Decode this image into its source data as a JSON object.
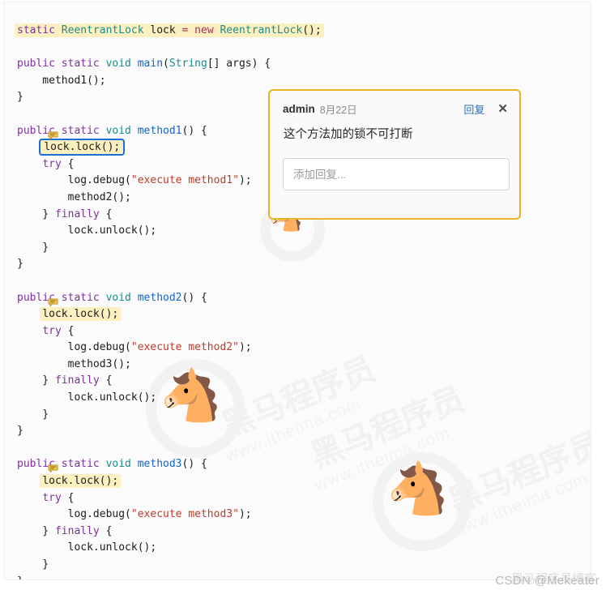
{
  "code": {
    "language": "java",
    "lines": [
      [
        {
          "t": "static ",
          "c": "kw"
        },
        {
          "t": "ReentrantLock",
          "c": "typ"
        },
        {
          "t": " lock ",
          "c": "pln"
        },
        {
          "t": "=",
          "c": "pnk"
        },
        {
          "t": " ",
          "c": "pln"
        },
        {
          "t": "new",
          "c": "pnk"
        },
        {
          "t": " ",
          "c": "pln"
        },
        {
          "t": "ReentrantLock",
          "c": "typ"
        },
        {
          "t": "();",
          "c": "pln"
        }
      ],
      [],
      [
        {
          "t": "public static ",
          "c": "kw"
        },
        {
          "t": "void",
          "c": "typ"
        },
        {
          "t": " ",
          "c": "pln"
        },
        {
          "t": "main",
          "c": "fn"
        },
        {
          "t": "(",
          "c": "pln"
        },
        {
          "t": "String",
          "c": "typ"
        },
        {
          "t": "[] args) {",
          "c": "pln"
        }
      ],
      [
        {
          "t": "    method1();",
          "c": "pln"
        }
      ],
      [
        {
          "t": "}",
          "c": "pln"
        }
      ],
      [],
      [
        {
          "t": "public static ",
          "c": "kw"
        },
        {
          "t": "void",
          "c": "typ"
        },
        {
          "t": " ",
          "c": "pln"
        },
        {
          "t": "method1",
          "c": "fn"
        },
        {
          "t": "() {",
          "c": "pln"
        }
      ],
      [
        {
          "t": "    ",
          "c": "pln"
        },
        {
          "t": "lock.lock();",
          "c": "pln"
        }
      ],
      [
        {
          "t": "    ",
          "c": "pln"
        },
        {
          "t": "try",
          "c": "kw"
        },
        {
          "t": " {",
          "c": "pln"
        }
      ],
      [
        {
          "t": "        log.debug(",
          "c": "pln"
        },
        {
          "t": "\"execute method1\"",
          "c": "str"
        },
        {
          "t": ");",
          "c": "pln"
        }
      ],
      [
        {
          "t": "        method2();",
          "c": "pln"
        }
      ],
      [
        {
          "t": "    } ",
          "c": "pln"
        },
        {
          "t": "finally",
          "c": "kw"
        },
        {
          "t": " {",
          "c": "pln"
        }
      ],
      [
        {
          "t": "        lock.unlock();",
          "c": "pln"
        }
      ],
      [
        {
          "t": "    }",
          "c": "pln"
        }
      ],
      [
        {
          "t": "}",
          "c": "pln"
        }
      ],
      [],
      [
        {
          "t": "public static ",
          "c": "kw"
        },
        {
          "t": "void",
          "c": "typ"
        },
        {
          "t": " ",
          "c": "pln"
        },
        {
          "t": "method2",
          "c": "fn"
        },
        {
          "t": "() {",
          "c": "pln"
        }
      ],
      [
        {
          "t": "    ",
          "c": "pln"
        },
        {
          "t": "lock.lock();",
          "c": "pln"
        }
      ],
      [
        {
          "t": "    ",
          "c": "pln"
        },
        {
          "t": "try",
          "c": "kw"
        },
        {
          "t": " {",
          "c": "pln"
        }
      ],
      [
        {
          "t": "        log.debug(",
          "c": "pln"
        },
        {
          "t": "\"execute method2\"",
          "c": "str"
        },
        {
          "t": ");",
          "c": "pln"
        }
      ],
      [
        {
          "t": "        method3();",
          "c": "pln"
        }
      ],
      [
        {
          "t": "    } ",
          "c": "pln"
        },
        {
          "t": "finally",
          "c": "kw"
        },
        {
          "t": " {",
          "c": "pln"
        }
      ],
      [
        {
          "t": "        lock.unlock();",
          "c": "pln"
        }
      ],
      [
        {
          "t": "    }",
          "c": "pln"
        }
      ],
      [
        {
          "t": "}",
          "c": "pln"
        }
      ],
      [],
      [
        {
          "t": "public static ",
          "c": "kw"
        },
        {
          "t": "void",
          "c": "typ"
        },
        {
          "t": " ",
          "c": "pln"
        },
        {
          "t": "method3",
          "c": "fn"
        },
        {
          "t": "() {",
          "c": "pln"
        }
      ],
      [
        {
          "t": "    ",
          "c": "pln"
        },
        {
          "t": "lock.lock();",
          "c": "pln"
        }
      ],
      [
        {
          "t": "    ",
          "c": "pln"
        },
        {
          "t": "try",
          "c": "kw"
        },
        {
          "t": " {",
          "c": "pln"
        }
      ],
      [
        {
          "t": "        log.debug(",
          "c": "pln"
        },
        {
          "t": "\"execute method3\"",
          "c": "str"
        },
        {
          "t": ");",
          "c": "pln"
        }
      ],
      [
        {
          "t": "    } ",
          "c": "pln"
        },
        {
          "t": "finally",
          "c": "kw"
        },
        {
          "t": " {",
          "c": "pln"
        }
      ],
      [
        {
          "t": "        lock.unlock();",
          "c": "pln"
        }
      ],
      [
        {
          "t": "    }",
          "c": "pln"
        }
      ],
      [
        {
          "t": "}",
          "c": "pln"
        }
      ]
    ],
    "plain_text": [
      "static ReentrantLock lock = new ReentrantLock();",
      "",
      "public static void main(String[] args) {",
      "    method1();",
      "}",
      "",
      "public static void method1() {",
      "    lock.lock();",
      "    try {",
      "        log.debug(\"execute method1\");",
      "        method2();",
      "    } finally {",
      "        lock.unlock();",
      "    }",
      "}",
      "",
      "public static void method2() {",
      "    lock.lock();",
      "    try {",
      "        log.debug(\"execute method2\");",
      "        method3();",
      "    } finally {",
      "        lock.unlock();",
      "    }",
      "}",
      "",
      "public static void method3() {",
      "    lock.lock();",
      "    try {",
      "        log.debug(\"execute method3\");",
      "    } finally {",
      "        lock.unlock();",
      "    }",
      "}"
    ]
  },
  "highlights": {
    "declaration_line": "static ReentrantLock lock = new ReentrantLock();",
    "method1_lock": "lock.lock();",
    "method2_lock": "lock.lock();",
    "method3_lock": "lock.lock();",
    "highlight_color": "#fdf0c0",
    "selection_border_color": "#1a6fd4"
  },
  "comment_popup": {
    "author": "admin",
    "date": "8月22日",
    "reply_label": "回复",
    "close_label": "✕",
    "body": "这个方法加的锁不可打断",
    "reply_placeholder": "添加回复...",
    "reply_value": "",
    "border_color": "#e8b41f",
    "link_color": "#2a6ebb"
  },
  "gutter_icons": {
    "comment_bubble_name": "comment-bubble-icon",
    "count": 3,
    "color": "#f2c94c"
  },
  "watermarks": {
    "brand_cn": "黑马程序员",
    "brand_url": "www.itheima.com",
    "csdn": "CSDN @Mekeater",
    "csdn_overlay": "黑马程序员博客"
  }
}
